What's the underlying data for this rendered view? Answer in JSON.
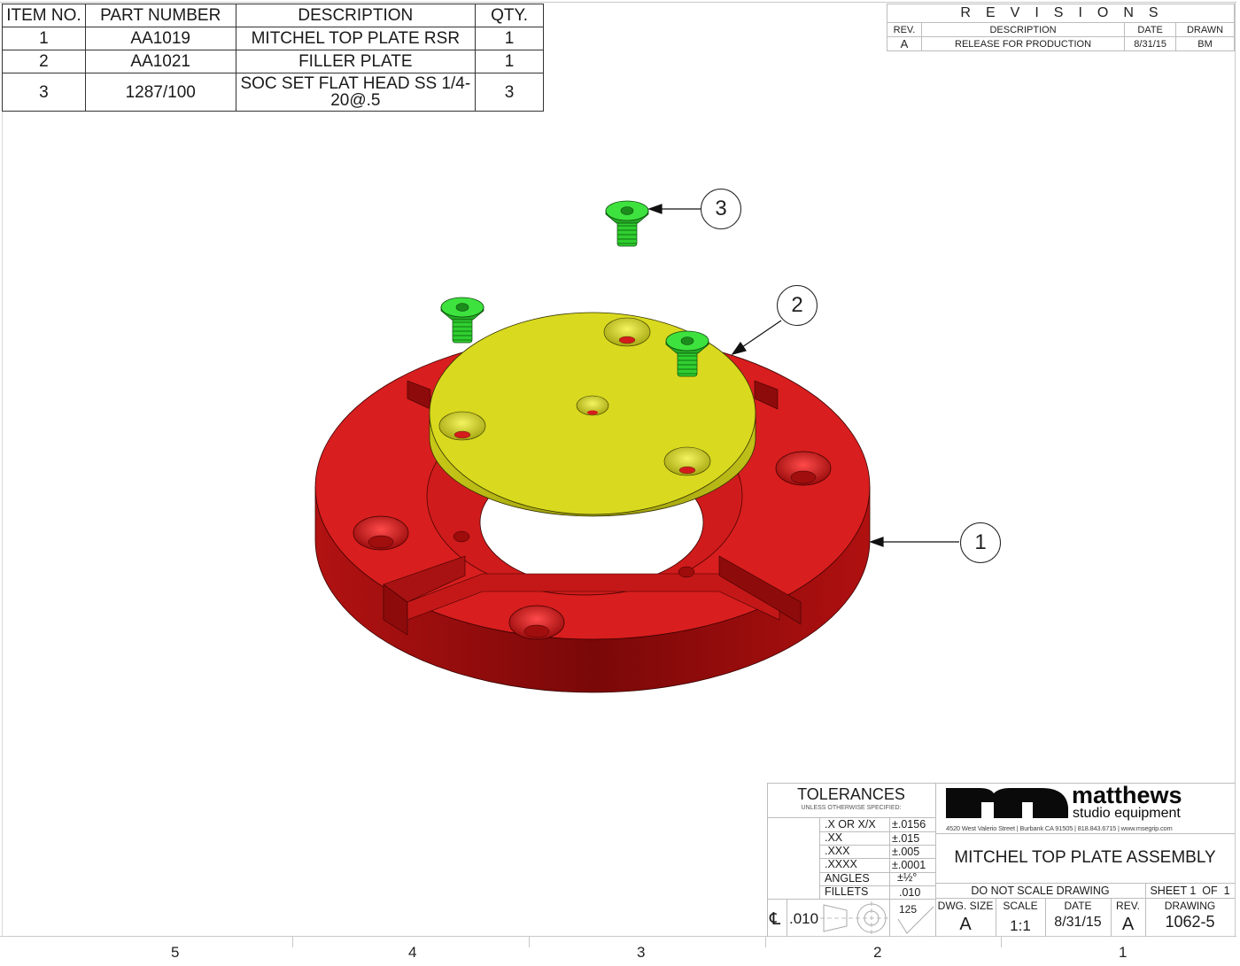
{
  "bom": {
    "headers": [
      "ITEM NO.",
      "PART NUMBER",
      "DESCRIPTION",
      "QTY."
    ],
    "rows": [
      {
        "item": "1",
        "part": "AA1019",
        "desc": "MITCHEL TOP PLATE RSR",
        "qty": "1"
      },
      {
        "item": "2",
        "part": "AA1021",
        "desc": "FILLER PLATE",
        "qty": "1"
      },
      {
        "item": "3",
        "part": "1287/100",
        "desc_line1": "SOC SET FLAT HEAD SS 1/4-",
        "desc_line2": "20@.5",
        "qty": "3"
      }
    ]
  },
  "revisions": {
    "title": "REVISIONS",
    "headers": [
      "REV.",
      "DESCRIPTION",
      "DATE",
      "DRAWN"
    ],
    "rows": [
      {
        "rev": "A",
        "desc": "RELEASE FOR PRODUCTION",
        "date": "8/31/15",
        "drawn": "BM"
      }
    ]
  },
  "balloons": [
    {
      "label": "1",
      "part": "MITCHEL TOP PLATE RSR"
    },
    {
      "label": "2",
      "part": "FILLER PLATE"
    },
    {
      "label": "3",
      "part": "SOC SET FLAT HEAD SS 1/4-20@.5"
    }
  ],
  "colors": {
    "top_plate": "#d81e1e",
    "top_plate_shadow": "#8a0c0c",
    "filler_plate": "#d8d81e",
    "filler_plate_shadow": "#a8a812",
    "screw": "#2ecc2e",
    "screw_dark": "#188a18"
  },
  "tolerances": {
    "title": "TOLERANCES",
    "subtitle": "UNLESS OTHERWISE SPECIFIED:",
    "rows": [
      {
        "label": ".X OR X/X",
        "value": "±.0156"
      },
      {
        "label": ".XX",
        "value": "±.015"
      },
      {
        "label": ".XXX",
        "value": "±.005"
      },
      {
        "label": ".XXXX",
        "value": "±.0001"
      },
      {
        "label": "ANGLES",
        "value": "±½°"
      },
      {
        "label": "FILLETS",
        "value": ".010"
      }
    ],
    "centerline_symbol": "℄",
    "centerline_value": ".010",
    "surface_finish": "125"
  },
  "company": {
    "logo_mark": "m",
    "name": "matthews",
    "tagline": "studio equipment",
    "address": "4520 West Valerio Street  |  Burbank CA 91505  |  818.843.6715  |  www.msegrip.com"
  },
  "title_block": {
    "drawing_title": "MITCHEL TOP PLATE ASSEMBLY",
    "do_not_scale": "DO NOT SCALE DRAWING",
    "sheet": "SHEET 1  OF  1",
    "dwg_size_label": "DWG. SIZE",
    "dwg_size": "A",
    "scale_label": "SCALE",
    "scale": "1:1",
    "date_label": "DATE",
    "date": "8/31/15",
    "rev_label": "REV.",
    "rev": "A",
    "drawing_label": "DRAWING",
    "drawing_number": "1062-5"
  },
  "zones": [
    "5",
    "4",
    "3",
    "2",
    "1"
  ]
}
